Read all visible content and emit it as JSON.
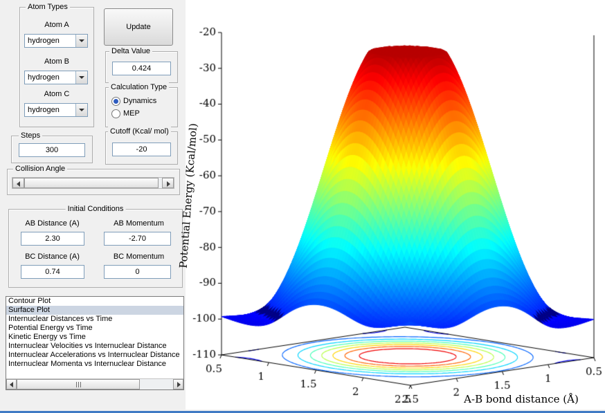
{
  "panel": {
    "atom_types": {
      "title": "Atom Types",
      "fields": [
        {
          "label": "Atom A",
          "value": "hydrogen"
        },
        {
          "label": "Atom B",
          "value": "hydrogen"
        },
        {
          "label": "Atom C",
          "value": "hydrogen"
        }
      ]
    },
    "update_button_label": "Update",
    "delta": {
      "title": "Delta Value",
      "value": "0.424"
    },
    "calculation_type": {
      "title": "Calculation Type",
      "options": [
        {
          "label": "Dynamics",
          "selected": true
        },
        {
          "label": "MEP",
          "selected": false
        }
      ]
    },
    "steps": {
      "title": "Steps",
      "value": "300"
    },
    "cutoff": {
      "title": "Cutoff (Kcal/ mol)",
      "value": "-20"
    },
    "collision_angle": {
      "title": "Collision Angle"
    },
    "initial_conditions": {
      "title": "Initial Conditions",
      "fields": [
        {
          "label": "AB Distance (A)",
          "value": "2.30"
        },
        {
          "label": "AB Momentum",
          "value": "-2.70"
        },
        {
          "label": "BC Distance (A)",
          "value": "0.74"
        },
        {
          "label": "BC Momentum",
          "value": "0"
        }
      ]
    },
    "plot_list": {
      "items": [
        "Contour Plot",
        "Surface Plot",
        "Internuclear Distances vs Time",
        "Potential Energy vs Time",
        "Kinetic Energy vs Time",
        "Internuclear Velocities vs Internuclear Distance",
        "Internuclear Accelerations vs Internuclear Distance",
        "Internuclear Momenta vs Internuclear Distance"
      ],
      "selected_index": 1
    }
  },
  "chart_data": {
    "type": "surface",
    "xlabel": "A-B bond distance (Å)",
    "zlabel": "Potential Energy (Kcal/mol)",
    "x_range": [
      0.5,
      2.5
    ],
    "y_range": [
      0.5,
      2.5
    ],
    "z_range": [
      -110,
      -20
    ],
    "x_ticks": [
      "0.5",
      "1",
      "1.5",
      "2",
      "2.5"
    ],
    "y_ticks": [
      "0.5",
      "1",
      "1.5",
      "2",
      "2.5"
    ],
    "z_ticks": [
      "-20",
      "-30",
      "-40",
      "-50",
      "-60",
      "-70",
      "-80",
      "-90",
      "-100",
      "-110"
    ],
    "colormap": "jet",
    "legend": "none",
    "grid": false,
    "contour_levels": [
      -100,
      -90,
      -80,
      -70,
      -60,
      -50,
      -40,
      -30
    ],
    "surface_model": {
      "base": -110,
      "amplitude": 92,
      "k": 1.9,
      "p": 1.3,
      "bowl_lift": 9,
      "front_lift": 12,
      "front_threshold": 1.2,
      "ripple_amp": 1.6,
      "ripple_freq": 14,
      "ripple_center": -99,
      "ripple_width": 6,
      "clip": -25,
      "band_levels": [
        -103,
        -97
      ],
      "band_halfwidth": 1.1,
      "band_color": "#000086"
    }
  }
}
